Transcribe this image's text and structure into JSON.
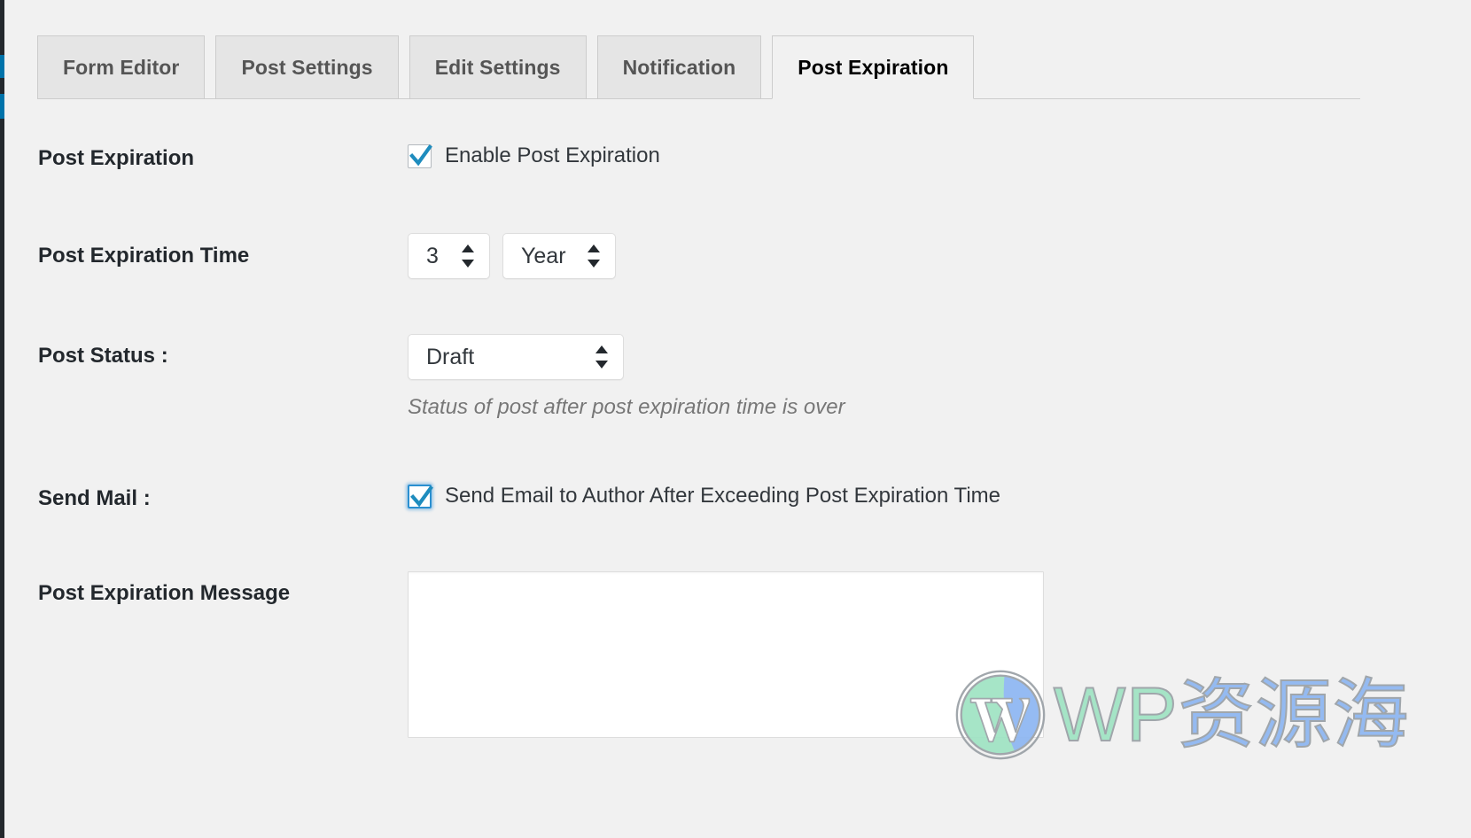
{
  "tabs": [
    {
      "label": "Form Editor",
      "active": false
    },
    {
      "label": "Post Settings",
      "active": false
    },
    {
      "label": "Edit Settings",
      "active": false
    },
    {
      "label": "Notification",
      "active": false
    },
    {
      "label": "Post Expiration",
      "active": true
    }
  ],
  "rows": {
    "post_expiration": {
      "label": "Post Expiration",
      "checkbox_label": "Enable Post Expiration",
      "checked": true
    },
    "post_expiration_time": {
      "label": "Post Expiration Time",
      "amount_value": "3",
      "unit_value": "Year"
    },
    "post_status": {
      "label": "Post Status :",
      "value": "Draft",
      "help": "Status of post after post expiration time is over"
    },
    "send_mail": {
      "label": "Send Mail :",
      "checkbox_label": "Send Email to Author After Exceeding Post Expiration Time",
      "checked": true
    },
    "post_expiration_message": {
      "label": "Post Expiration Message",
      "value": "",
      "placeholder": ""
    }
  },
  "watermark": {
    "text_en": "WP",
    "text_cn": "资源海"
  },
  "colors": {
    "accent_blue": "#0073aa",
    "checkbox_check": "#1e8cbe",
    "admin_dark": "#23282d",
    "page_bg": "#f1f1f1",
    "tab_inactive_bg": "#e5e5e5",
    "border_gray": "#cccccc",
    "help_text_gray": "#777777",
    "watermark_green": "#9fe3c3",
    "watermark_blue": "#8db6f2"
  }
}
